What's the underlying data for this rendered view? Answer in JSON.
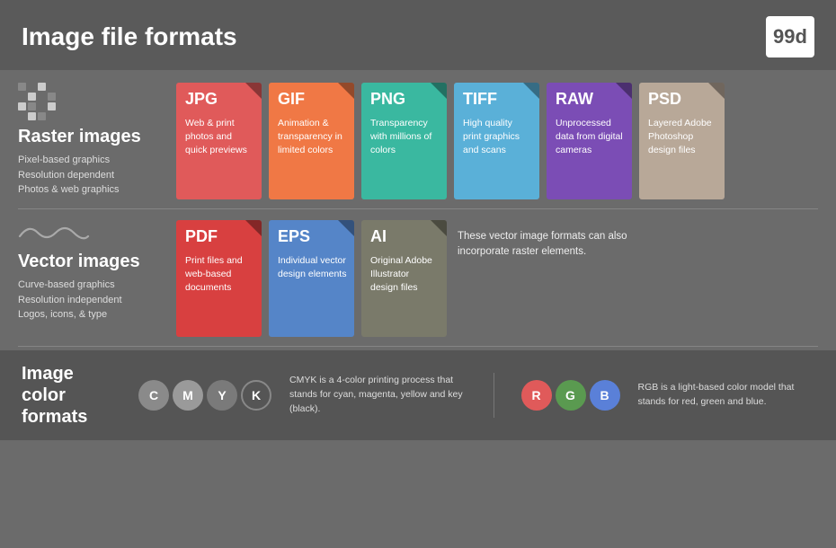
{
  "header": {
    "title": "Image file formats",
    "logo": "99d"
  },
  "raster": {
    "section_title": "Raster images",
    "desc_lines": [
      "Pixel-based graphics",
      "Resolution dependent",
      "Photos & web graphics"
    ],
    "cards": [
      {
        "id": "jpg",
        "label": "JPG",
        "color": "card-jpg",
        "body": "Web & print photos and quick previews"
      },
      {
        "id": "gif",
        "label": "GIF",
        "color": "card-gif",
        "body": "Animation & transparency in limited colors"
      },
      {
        "id": "png",
        "label": "PNG",
        "color": "card-png",
        "body": "Transparency with millions of colors"
      },
      {
        "id": "tiff",
        "label": "TIFF",
        "color": "card-tiff",
        "body": "High quality print graphics and scans"
      },
      {
        "id": "raw",
        "label": "RAW",
        "color": "card-raw",
        "body": "Unprocessed data from digital cameras"
      },
      {
        "id": "psd",
        "label": "PSD",
        "color": "card-psd",
        "body": "Layered Adobe Photoshop design files"
      }
    ]
  },
  "vector": {
    "section_title": "Vector images",
    "desc_lines": [
      "Curve-based graphics",
      "Resolution independent",
      "Logos, icons, & type"
    ],
    "cards": [
      {
        "id": "pdf",
        "label": "PDF",
        "color": "card-pdf",
        "body": "Print files and web-based documents"
      },
      {
        "id": "eps",
        "label": "EPS",
        "color": "card-eps",
        "body": "Individual vector design elements"
      },
      {
        "id": "ai",
        "label": "AI",
        "color": "card-ai",
        "body": "Original Adobe Illustrator design files"
      }
    ],
    "note": "These vector image formats can also incorporate raster elements."
  },
  "color_formats": {
    "title": "Image color formats",
    "cmyk": {
      "letters": [
        "C",
        "M",
        "Y",
        "K"
      ],
      "desc": "CMYK is a 4-color printing process that stands for cyan, magenta, yellow and key (black)."
    },
    "rgb": {
      "letters": [
        "R",
        "G",
        "B"
      ],
      "desc": "RGB is a light-based color model that stands for red, green and blue."
    }
  }
}
